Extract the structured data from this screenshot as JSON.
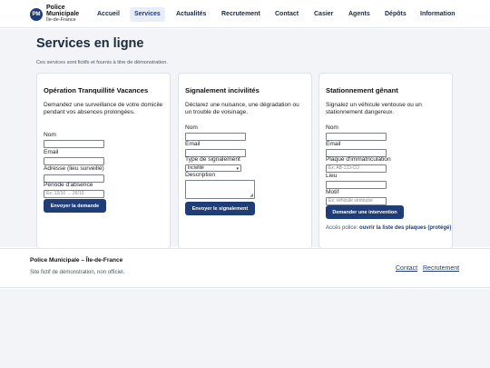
{
  "brand": {
    "badge": "PM",
    "line1": "Police",
    "line2": "Municipale",
    "line3": "Île-de-France"
  },
  "nav": {
    "items": [
      {
        "label": "Accueil"
      },
      {
        "label": "Services"
      },
      {
        "label": "Actualités"
      },
      {
        "label": "Recrutement"
      },
      {
        "label": "Contact"
      },
      {
        "label": "Casier"
      },
      {
        "label": "Agents"
      },
      {
        "label": "Dépôts"
      },
      {
        "label": "Information"
      }
    ],
    "active": "Services"
  },
  "page": {
    "title": "Services en ligne",
    "note": "Ces services sont fictifs et fournis à titre de démonstration."
  },
  "cards": [
    {
      "title": "Opération Tranquillité Vacances",
      "desc": "Demandez une surveillance de votre domicile pendant vos absences prolongées.",
      "fields": [
        {
          "label": "Nom",
          "value": ""
        },
        {
          "label": "Email",
          "value": ""
        },
        {
          "label": "Adresse (lieu surveillé)",
          "value": ""
        },
        {
          "label": "Période d'absence",
          "placeholder": "Ex: 12/10 → 26/10"
        }
      ],
      "button": "Envoyer la demande"
    },
    {
      "title": "Signalement incivilités",
      "desc": "Déclarez une nuisance, une dégradation ou un trouble de voisinage.",
      "fields": [
        {
          "label": "Nom",
          "value": ""
        },
        {
          "label": "Email",
          "value": ""
        },
        {
          "label": "Type de signalement",
          "selected": "Incivilité"
        },
        {
          "label": "Description",
          "value": ""
        }
      ],
      "button": "Envoyer le signalement"
    },
    {
      "title": "Stationnement gênant",
      "desc": "Signalez un véhicule ventouse ou un stationnement dangereux.",
      "fields": [
        {
          "label": "Nom",
          "value": ""
        },
        {
          "label": "Email",
          "value": ""
        },
        {
          "label": "Plaque d'immatriculation",
          "placeholder": "Ex: AB-123-CD"
        },
        {
          "label": "Lieu",
          "value": ""
        },
        {
          "label": "Motif",
          "placeholder": "Ex: véhicule ventouse"
        }
      ],
      "button": "Demander une intervention",
      "access_prefix": "Accès police:",
      "access_link": "ouvrir la liste des plaques (protégé)"
    }
  ],
  "footer": {
    "title": "Police Municipale – Île-de-France",
    "note": "Site fictif de démonstration, non officiel.",
    "links": [
      "Contact",
      "Recrutement"
    ]
  },
  "colors": {
    "primary": "#1f3e78",
    "nav_active_bg": "#e8eef8",
    "page_bg": "#f2f4f7"
  }
}
